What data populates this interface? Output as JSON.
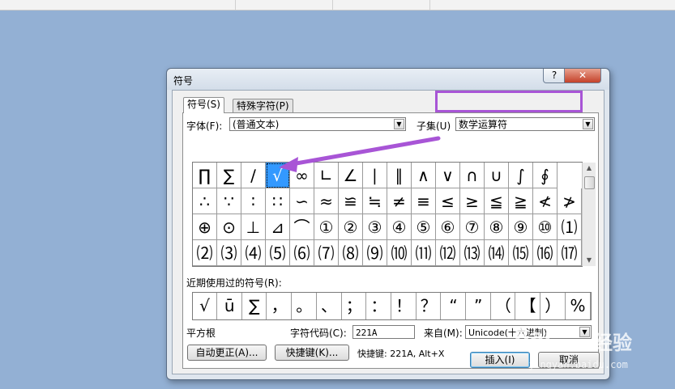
{
  "dialog": {
    "title": "符号",
    "help_glyph": "?",
    "close_glyph": "✕"
  },
  "tabs": [
    {
      "label": "符号(S)"
    },
    {
      "label": "特殊字符(P)"
    }
  ],
  "font": {
    "label": "字体(F):",
    "value": "(普通文本)"
  },
  "subset": {
    "label": "子集(U)",
    "value": "数学运算符"
  },
  "symbols": {
    "rows": [
      [
        "∏",
        "∑",
        "∕",
        "√",
        "∞",
        "∟",
        "∠",
        "∣",
        "∥",
        "∧",
        "∨",
        "∩",
        "∪",
        "∫",
        "∮"
      ],
      [
        "∴",
        "∵",
        "∶",
        "∷",
        "∽",
        "≈",
        "≌",
        "≒",
        "≠",
        "≡",
        "≤",
        "≥",
        "≦",
        "≧",
        "≮",
        "≯"
      ],
      [
        "⊕",
        "⊙",
        "⊥",
        "⊿",
        "⌒",
        "①",
        "②",
        "③",
        "④",
        "⑤",
        "⑥",
        "⑦",
        "⑧",
        "⑨",
        "⑩",
        "⑴"
      ],
      [
        "⑵",
        "⑶",
        "⑷",
        "⑸",
        "⑹",
        "⑺",
        "⑻",
        "⑼",
        "⑽",
        "⑾",
        "⑿",
        "⒀",
        "⒁",
        "⒂",
        "⒃",
        "⒄"
      ]
    ],
    "selected_char": "√"
  },
  "recent": {
    "label": "近期使用过的符号(R):",
    "items": [
      "√",
      "ū",
      "∑",
      "，",
      "。",
      "、",
      "；",
      "：",
      "！",
      "？",
      "“",
      "”",
      "（",
      "【",
      "）",
      "%"
    ]
  },
  "char_name": "平方根",
  "char_code": {
    "label": "字符代码(C):",
    "value": "221A"
  },
  "from": {
    "label": "来自(M):",
    "value": "Unicode(十六进制)"
  },
  "buttons": {
    "autocorrect": "自动更正(A)...",
    "shortcut_key": "快捷键(K)...",
    "insert": "插入(I)",
    "cancel": "取消"
  },
  "shortcut_text": "快捷键: 221A, Alt+X",
  "annotation_color": "#a855d6",
  "selection_color": "#3399ff",
  "watermark": {
    "logo": "Bai",
    "brand": "经验",
    "url": "jingyan.baidu.com"
  }
}
